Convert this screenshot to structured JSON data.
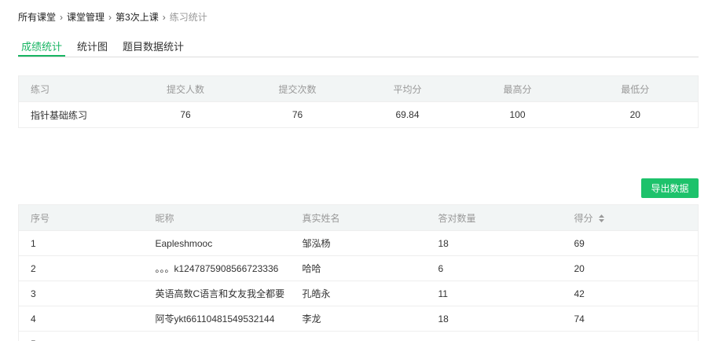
{
  "breadcrumb": {
    "items": [
      "所有课堂",
      "课堂管理",
      "第3次上课"
    ],
    "current": "练习统计"
  },
  "tabs": [
    {
      "label": "成绩统计",
      "active": true
    },
    {
      "label": "统计图",
      "active": false
    },
    {
      "label": "题目数据统计",
      "active": false
    }
  ],
  "summary": {
    "headers": [
      "练习",
      "提交人数",
      "提交次数",
      "平均分",
      "最高分",
      "最低分"
    ],
    "rows": [
      [
        "指针基础练习",
        "76",
        "76",
        "69.84",
        "100",
        "20"
      ]
    ]
  },
  "export_label": "导出数据",
  "students": {
    "headers": [
      "序号",
      "昵称",
      "真实姓名",
      "答对数量",
      "得分"
    ],
    "rows": [
      [
        "1",
        "Eapleshmooc",
        "邹泓杨",
        "18",
        "69"
      ],
      [
        "2",
        "。。。k1247875908566723336",
        "哈哈",
        "6",
        "20"
      ],
      [
        "3",
        "英语高数C语言和女友我全都要",
        "孔皓永",
        "11",
        "42"
      ],
      [
        "4",
        "阿苓ykt66110481549532144",
        "李龙",
        "18",
        "74"
      ],
      [
        "5",
        "",
        "",
        "",
        ""
      ]
    ]
  },
  "colors": {
    "accent": "#18b563",
    "button": "#1dc26b"
  }
}
